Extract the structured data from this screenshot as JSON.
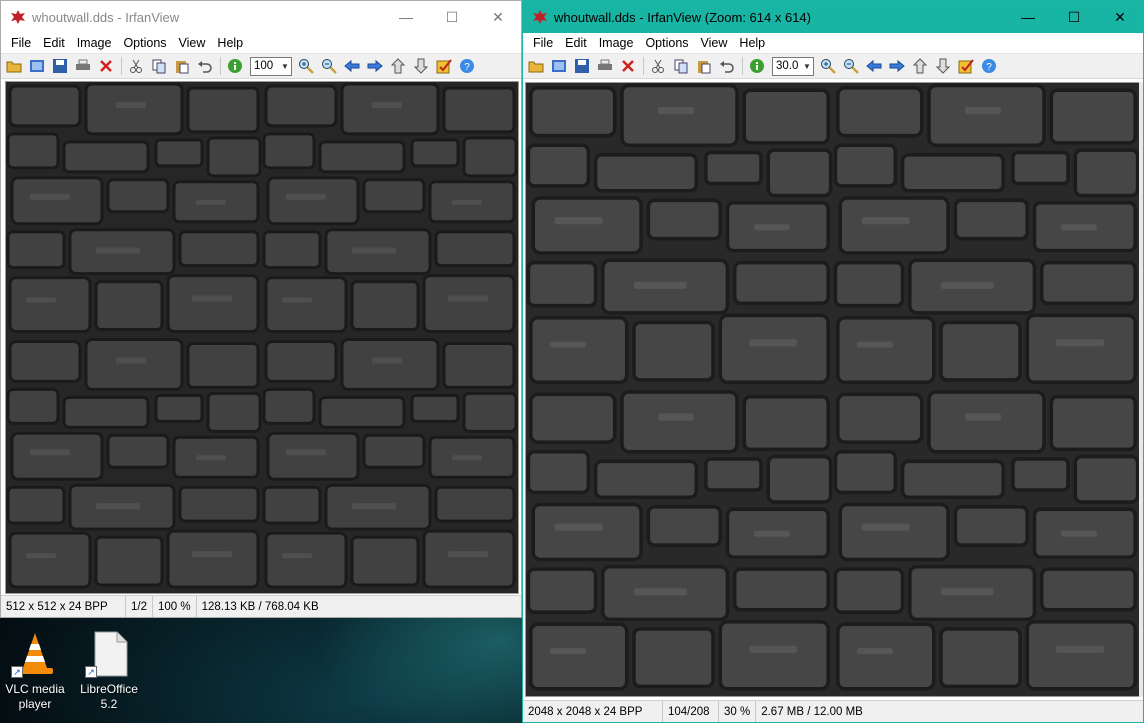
{
  "desktop": {
    "icons": [
      {
        "label_line1": "VLC media",
        "label_line2": "player",
        "icon": "vlc-cone-icon"
      },
      {
        "label_line1": "LibreOffice",
        "label_line2": "5.2",
        "icon": "libreoffice-document-icon"
      }
    ]
  },
  "menu": [
    "File",
    "Edit",
    "Image",
    "Options",
    "View",
    "Help"
  ],
  "toolbar_icons": [
    "open-folder-icon",
    "thumbnails-icon",
    "save-icon",
    "print-icon",
    "delete-icon",
    "cut-icon",
    "copy-icon",
    "paste-icon",
    "undo-icon",
    "info-icon",
    "zoom-in-icon",
    "zoom-out-icon",
    "previous-icon",
    "next-icon",
    "page-up-icon",
    "page-down-icon",
    "properties-icon",
    "help-icon"
  ],
  "colors": {
    "active_titlebar": "#18b4a4",
    "inactive_title_text": "#888888",
    "toolbar_bg": "#f0f0f0",
    "stone_base": "#3a3a3a"
  },
  "window_left": {
    "title": "whoutwall.dds - IrfanView",
    "zoom_value": "100",
    "status": {
      "dims": "512 x 512 x 24 BPP",
      "page": "1/2",
      "zoom": "100 %",
      "size": "128.13 KB / 768.04 KB"
    }
  },
  "window_right": {
    "title": "whoutwall.dds - IrfanView (Zoom: 614 x 614)",
    "zoom_value": "30.0",
    "status": {
      "dims": "2048 x 2048 x 24 BPP",
      "page": "104/208",
      "zoom": "30 %",
      "size": "2.67 MB / 12.00 MB"
    }
  }
}
